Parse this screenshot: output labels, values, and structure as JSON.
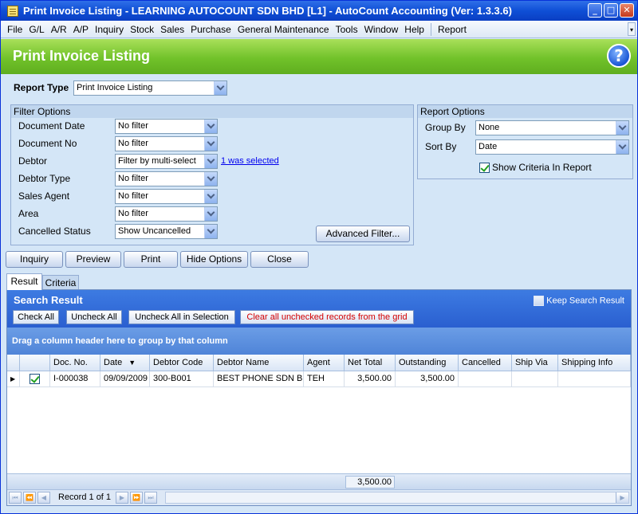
{
  "window": {
    "title": "Print Invoice Listing - LEARNING AUTOCOUNT SDN BHD [L1] - AutoCount Accounting (Ver: 1.3.3.6)",
    "minimize": "_",
    "maximize": "□",
    "close": "✕"
  },
  "menu": [
    "File",
    "G/L",
    "A/R",
    "A/P",
    "Inquiry",
    "Stock",
    "Sales",
    "Purchase",
    "General Maintenance",
    "Tools",
    "Window",
    "Help",
    "Report"
  ],
  "header": {
    "title": "Print Invoice Listing",
    "help": "?"
  },
  "report_type": {
    "label": "Report Type",
    "value": "Print Invoice Listing"
  },
  "filter_options": {
    "title": "Filter Options",
    "rows": [
      {
        "label": "Document Date",
        "value": "No filter"
      },
      {
        "label": "Document No",
        "value": "No filter"
      },
      {
        "label": "Debtor",
        "value": "Filter by multi-select",
        "link": "1 was selected"
      },
      {
        "label": "Debtor Type",
        "value": "No filter"
      },
      {
        "label": "Sales Agent",
        "value": "No filter"
      },
      {
        "label": "Area",
        "value": "No filter"
      },
      {
        "label": "Cancelled Status",
        "value": "Show Uncancelled"
      }
    ],
    "advanced_button": "Advanced Filter..."
  },
  "report_options": {
    "title": "Report Options",
    "group_by": {
      "label": "Group By",
      "value": "None"
    },
    "sort_by": {
      "label": "Sort By",
      "value": "Date"
    },
    "show_criteria": {
      "label": "Show Criteria In Report",
      "checked": true
    }
  },
  "actions": [
    "Inquiry",
    "Preview",
    "Print",
    "Hide Options",
    "Close"
  ],
  "tabs": [
    {
      "label": "Result",
      "active": true
    },
    {
      "label": "Criteria",
      "active": false
    }
  ],
  "search_result": {
    "title": "Search Result",
    "keep_label": "Keep Search Result",
    "buttons": [
      "Check All",
      "Uncheck All",
      "Uncheck All in Selection",
      "Clear all unchecked records from the grid"
    ]
  },
  "grid": {
    "group_hint": "Drag a column header here to group by that column",
    "columns": [
      "Doc. No.",
      "Date",
      "Debtor Code",
      "Debtor Name",
      "Agent",
      "Net Total",
      "Outstanding",
      "Cancelled",
      "Ship Via",
      "Shipping Info"
    ],
    "rows": [
      {
        "checked": true,
        "cells": [
          "I-000038",
          "09/09/2009",
          "300-B001",
          "BEST PHONE SDN B...",
          "TEH",
          "3,500.00",
          "3,500.00",
          "",
          "",
          ""
        ]
      }
    ],
    "footer_total": "3,500.00",
    "record_text": "Record 1 of 1"
  },
  "colors": {
    "title_bar": "#0f4fd6",
    "header_green": "#71c22a",
    "result_bar": "#2a5fd0",
    "clear_text": "#d40000"
  }
}
